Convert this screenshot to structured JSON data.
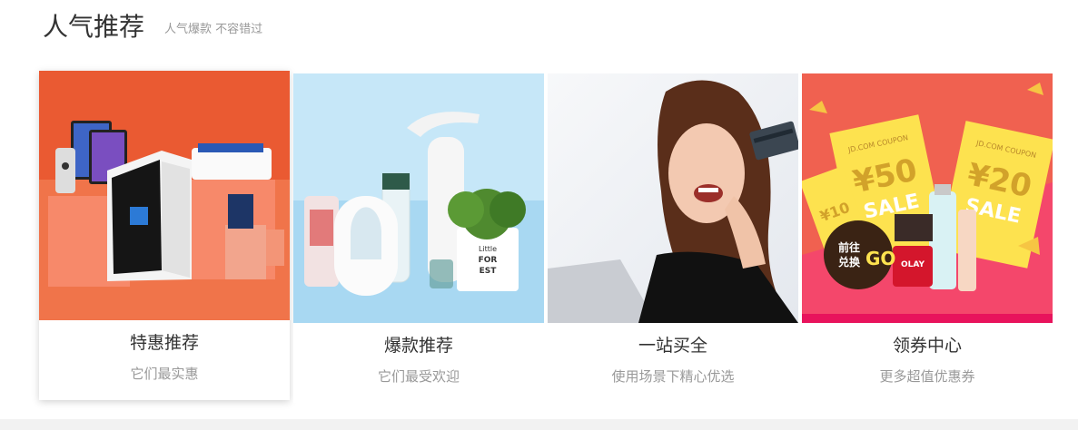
{
  "section": {
    "title": "人气推荐",
    "subtitle": "人气爆款 不容错过"
  },
  "cards": [
    {
      "title": "特惠推荐",
      "desc": "它们最实惠",
      "image": "electronics-products"
    },
    {
      "title": "爆款推荐",
      "desc": "它们最受欢迎",
      "image": "home-appliances-products",
      "image_text": {
        "pot_line1": "Little",
        "pot_line2": "FOR",
        "pot_line3": "EST"
      }
    },
    {
      "title": "一站买全",
      "desc": "使用场景下精心优选",
      "image": "woman-with-credit-card"
    },
    {
      "title": "领券中心",
      "desc": "更多超值优惠券",
      "image": "coupon-cosmetics",
      "coupon": {
        "brand": "JD.COM COUPON",
        "amount1": "¥50",
        "amount2": "¥20",
        "amount3": "¥10",
        "sale": "SALE",
        "cta_line1": "前往",
        "cta_line2": "兑换",
        "cta_go": "GO",
        "product": "OLAY"
      }
    }
  ],
  "colors": {
    "accent_orange": "#f0623c",
    "coupon_pink": "#f4476b",
    "coupon_yellow": "#fde24f"
  }
}
